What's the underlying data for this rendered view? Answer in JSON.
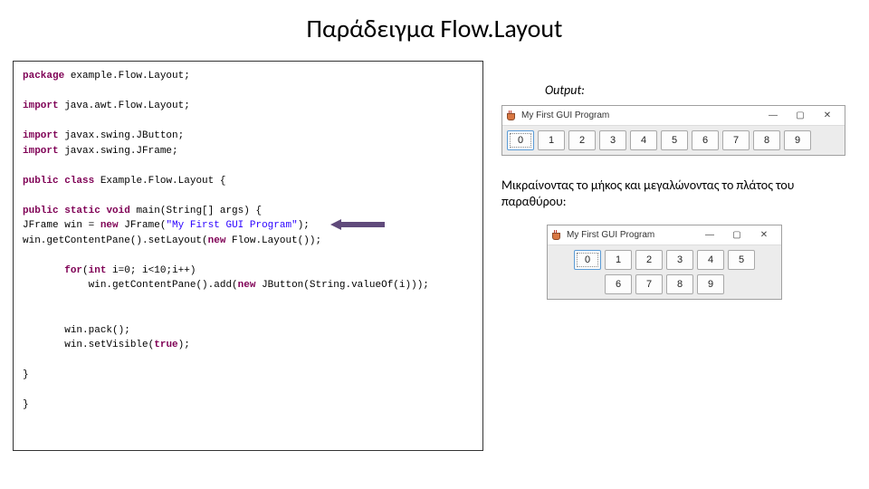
{
  "title": "Παράδειγμα Flow.Layout",
  "code": {
    "kw_package": "package",
    "pkg": " example.Flow.Layout;",
    "kw_import": "import",
    "imp1": " java.awt.Flow.Layout;",
    "imp2": " javax.swing.JButton;",
    "imp3": " javax.swing.JFrame;",
    "kw_public": "public",
    "kw_class": "class",
    "cls": " Example.Flow.Layout {",
    "kw_static": "static",
    "kw_void": "void",
    "main_sig": " main(String[] args) {",
    "jf1": "JFrame win = ",
    "kw_new": "new",
    "jf2": " JFrame(",
    "jf_title": "\"My First GUI Program\"",
    "jf3": ");",
    "layout1": "win.getContentPane().setLayout(",
    "layout2": " Flow.Layout());",
    "kw_for": "for",
    "kw_int": "int",
    "for_sig": " i=0; i<10;i++)",
    "add1": "win.getContentPane().add(",
    "add2": " JButton(String.valueOf(i)));",
    "pack": "win.pack();",
    "kw_true": "true",
    "vis1": "win.setVisible(",
    "vis2": ");",
    "brace": "}"
  },
  "output_label": "Output:",
  "note": "Μικραίνοντας το μήκος και μεγαλώνοντας το πλάτος του παραθύρου:",
  "win1": {
    "title": "My First GUI Program",
    "min": "—",
    "max": "▢",
    "close": "✕",
    "buttons": [
      "0",
      "1",
      "2",
      "3",
      "4",
      "5",
      "6",
      "7",
      "8",
      "9"
    ]
  },
  "win2": {
    "title": "My First GUI Program",
    "min": "—",
    "max": "▢",
    "close": "✕",
    "row1": [
      "0",
      "1",
      "2",
      "3",
      "4",
      "5"
    ],
    "row2": [
      "6",
      "7",
      "8",
      "9"
    ]
  }
}
